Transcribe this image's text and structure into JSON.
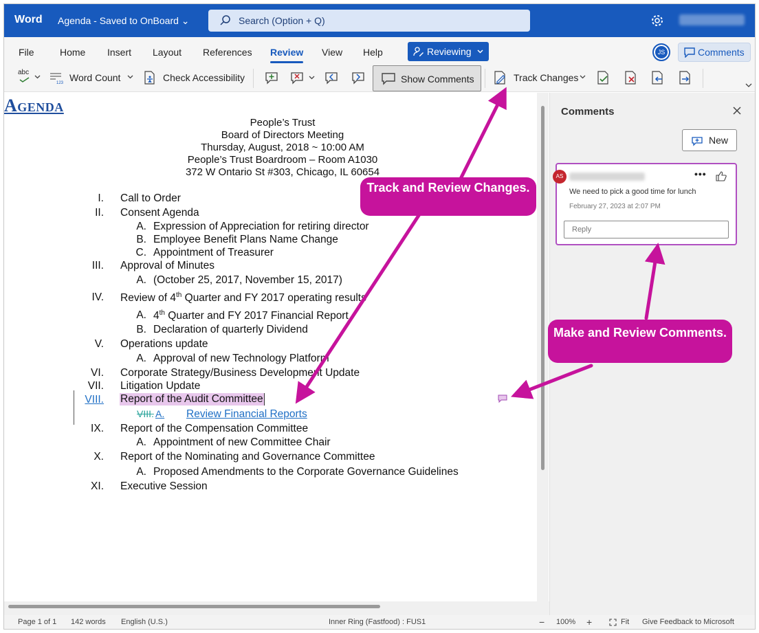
{
  "titlebar": {
    "app_name": "Word",
    "doc_title": "Agenda  - Saved to OnBoard",
    "search_placeholder": "Search (Option + Q)",
    "settings_icon": "gear-icon",
    "user_name_blurred": "Andrew Sompek"
  },
  "tabs": {
    "items": [
      "File",
      "Home",
      "Insert",
      "Layout",
      "References",
      "Review",
      "View",
      "Help"
    ],
    "active": "Review",
    "mode_button": "Reviewing",
    "avatar_initials": "JS",
    "comments_button": "Comments"
  },
  "toolbar": {
    "spelling_label": "abc",
    "word_count": "Word Count",
    "check_accessibility": "Check Accessibility",
    "show_comments": "Show Comments",
    "track_changes": "Track Changes"
  },
  "document": {
    "heading": "Agenda",
    "header_lines": [
      "People’s Trust",
      "Board of Directors Meeting",
      "Thursday, August, 2018 ~ 10:00 AM",
      "People’s Trust Boardroom – Room A1030",
      "372 W Ontario St #303, Chicago, IL 60654"
    ],
    "items": {
      "i1": {
        "num": "I.",
        "text": "Call to Order"
      },
      "i2": {
        "num": "II.",
        "text": "Consent Agenda"
      },
      "i2a": {
        "num": "A.",
        "text": "Expression of Appreciation for retiring director"
      },
      "i2b": {
        "num": "B.",
        "text": "Employee Benefit Plans Name Change"
      },
      "i2c": {
        "num": "C.",
        "text": "Appointment of Treasurer"
      },
      "i3": {
        "num": "III.",
        "text": "Approval of Minutes"
      },
      "i3a": {
        "num": "A.",
        "text": "(October 25, 2017, November 15, 2017)"
      },
      "i4": {
        "num": "IV.",
        "pre": "Review of 4",
        "sup": "th",
        "post": " Quarter and FY 2017 operating results"
      },
      "i4a": {
        "num": "A.",
        "pre": "4",
        "sup": "th",
        "post": " Quarter and FY 2017 Financial Report"
      },
      "i4b": {
        "num": "B.",
        "text": " Declaration of quarterly Dividend"
      },
      "i5": {
        "num": "V.",
        "text": "Operations update"
      },
      "i5a": {
        "num": "A.",
        "text": "Approval of new Technology Platform"
      },
      "i6": {
        "num": "VI.",
        "text": "Corporate Strategy/Business Development Update"
      },
      "i7": {
        "num": "VII.",
        "text": "Litigation Update"
      },
      "i8": {
        "num": "VIII.",
        "text": "Report of the Audit Committee"
      },
      "i8a": {
        "deleted": "VIII.",
        "num": "A.",
        "text": "Review Financial Reports"
      },
      "i9": {
        "num": "IX.",
        "text": "Report of the Compensation Committee"
      },
      "i9a": {
        "num": "A.",
        "text": "Appointment of new Committee Chair"
      },
      "i10": {
        "num": "X.",
        "text": "Report of the Nominating and Governance Committee"
      },
      "i10a": {
        "num": "A.",
        "text": "Proposed Amendments to the Corporate Governance Guidelines"
      },
      "i11": {
        "num": "XI.",
        "text": "Executive Session"
      }
    }
  },
  "comments_pane": {
    "title": "Comments",
    "new_button": "New",
    "comment": {
      "avatar_initials": "AS",
      "author_blurred": "Andrew Sompek",
      "text": "We need to pick a good time for lunch",
      "date": "February 27, 2023 at 2:07 PM",
      "reply_placeholder": "Reply"
    }
  },
  "status_bar": {
    "page": "Page 1 of 1",
    "words": "142 words",
    "language": "English (U.S.)",
    "ring": "Inner Ring (Fastfood) : FUS1",
    "zoom": "100%",
    "fit": "Fit",
    "feedback": "Give Feedback to Microsoft"
  },
  "callouts": {
    "track": "Track and Review Changes.",
    "comments": "Make and Review Comments."
  },
  "colors": {
    "brand": "#185abd",
    "callout": "#c6139c",
    "comment_border": "#b04fc1",
    "highlight": "#e8c7ec"
  }
}
